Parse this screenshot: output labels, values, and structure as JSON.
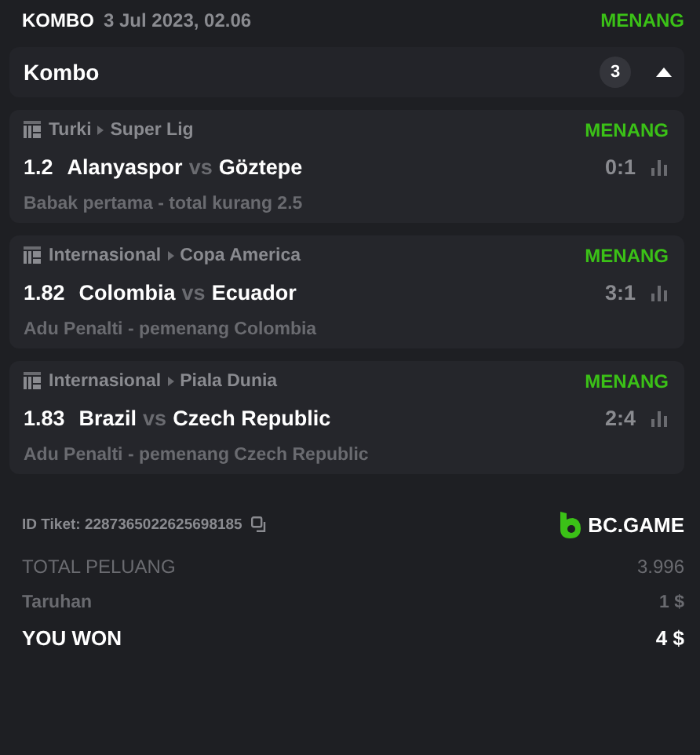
{
  "header": {
    "type": "KOMBO",
    "date": "3 Jul 2023, 02.06",
    "status": "MENANG"
  },
  "group": {
    "title": "Kombo",
    "count": "3",
    "expanded": true
  },
  "bets": [
    {
      "country": "Turki",
      "league": "Super Lig",
      "status": "MENANG",
      "odds": "1.2",
      "home": "Alanyaspor",
      "vs": "vs",
      "away": "Göztepe",
      "score": "0:1",
      "market": "Babak pertama - total kurang 2.5"
    },
    {
      "country": "Internasional",
      "league": "Copa America",
      "status": "MENANG",
      "odds": "1.82",
      "home": "Colombia",
      "vs": "vs",
      "away": "Ecuador",
      "score": "3:1",
      "market": "Adu Penalti - pemenang Colombia"
    },
    {
      "country": "Internasional",
      "league": "Piala Dunia",
      "status": "MENANG",
      "odds": "1.83",
      "home": "Brazil",
      "vs": "vs",
      "away": "Czech Republic",
      "score": "2:4",
      "market": "Adu Penalti - pemenang Czech Republic"
    }
  ],
  "ticket": {
    "id": "ID Tiket: 2287365022625698185",
    "brand": "BC.GAME"
  },
  "totals": [
    {
      "kind": "plain",
      "label": "TOTAL PELUANG",
      "value": "3.996"
    },
    {
      "kind": "plain",
      "label": "Taruhan",
      "value": "1 $"
    },
    {
      "kind": "strong",
      "label": "YOU WON",
      "value": "4 $"
    }
  ]
}
